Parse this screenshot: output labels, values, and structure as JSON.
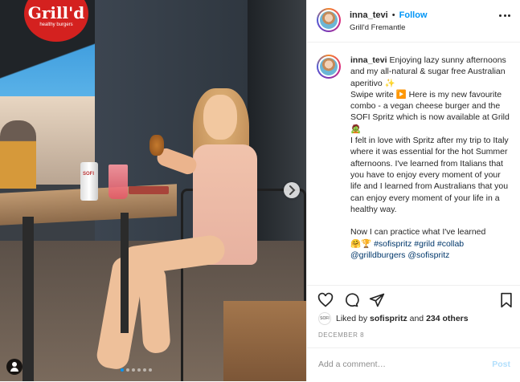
{
  "media": {
    "sign_line1": "Grill'd",
    "sign_line2": "healthy burgers",
    "cup_text": "SOFI",
    "carousel_count": 6,
    "carousel_active_index": 0
  },
  "header": {
    "username": "inna_tevi",
    "separator": "•",
    "follow_label": "Follow",
    "location": "Grill'd Fremantle"
  },
  "caption": {
    "username": "inna_tevi",
    "body_1": " Enjoying lazy sunny afternoons and my all-natural & sugar free Australian aperitivo ✨\nSwipe write ▶️ Here is my new favourite combo - a vegan cheese burger and the SOFI Spritz which is now available at Grild 🧟\nI felt in love with Spritz after my trip to Italy where it was essential for the hot Summer afternoons. I've learned from Italians that you have to enjoy every moment of your life and I learned from Australians that you can enjoy every moment of your life in a healthy way.\n\nNow I can practice what I've learned\n🤗🏆 ",
    "tags": "#sofispritz #grild #collab @grilldburgers @sofispritz"
  },
  "actions": {
    "like_icon": "heart-icon",
    "comment_icon": "comment-icon",
    "share_icon": "share-icon",
    "save_icon": "bookmark-icon"
  },
  "likes": {
    "avatar_text": "SOFI",
    "prefix": "Liked by ",
    "user": "sofispritz",
    "suffix": " and ",
    "others": "234 others"
  },
  "date": "DECEMBER 8",
  "comment": {
    "placeholder": "Add a comment…",
    "post_label": "Post"
  },
  "colors": {
    "accent": "#0095f6",
    "post_disabled": "#b2dffc",
    "sign_red": "#d4211f"
  }
}
